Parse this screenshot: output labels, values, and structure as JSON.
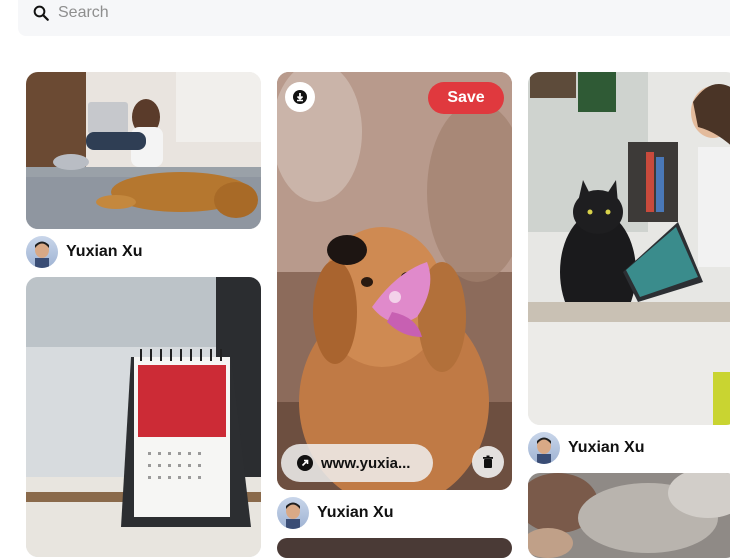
{
  "search": {
    "placeholder": "Search",
    "value": ""
  },
  "pins": [
    {
      "author": "Yuxian Xu",
      "image": "woman-laptop-bed-with-dog"
    },
    {
      "author": "",
      "image": "desk-calendar-life-is-short"
    },
    {
      "author": "Yuxian Xu",
      "image": "golden-retriever-with-pink-flower",
      "overlay": {
        "save_label": "Save",
        "link_text": "www.yuxia..."
      }
    },
    {
      "author": "Yuxian Xu",
      "image": "woman-laptop-black-cat-desk"
    },
    {
      "author": "",
      "image": "clouds-painting"
    }
  ],
  "colors": {
    "save_button": "#e0393e",
    "text": "#111111",
    "search_bg": "#f6f7f9"
  },
  "icons": [
    "search-icon",
    "download-icon",
    "arrow-up-right-icon",
    "trash-icon",
    "avatar"
  ]
}
